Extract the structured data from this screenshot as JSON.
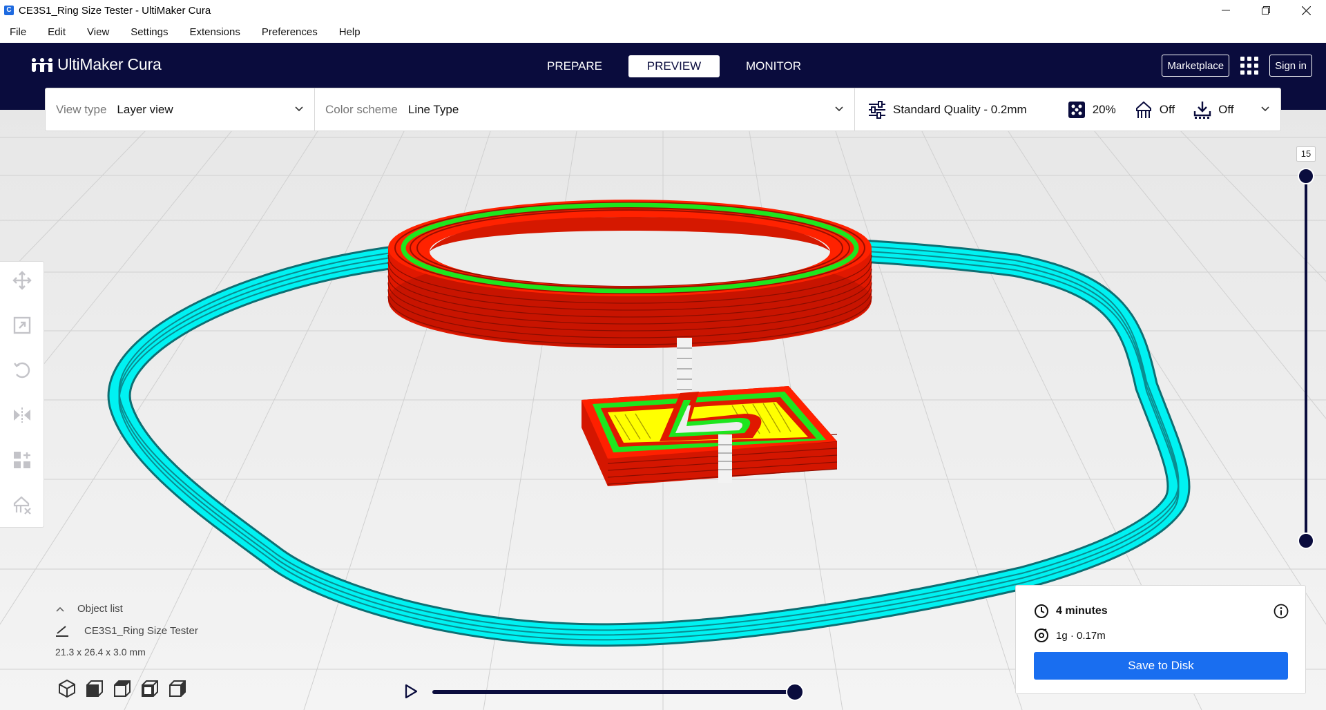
{
  "window": {
    "title": "CE3S1_Ring Size Tester - UltiMaker Cura",
    "app_icon_letter": "C"
  },
  "menu": [
    "File",
    "Edit",
    "View",
    "Settings",
    "Extensions",
    "Preferences",
    "Help"
  ],
  "header": {
    "brand": "UltiMaker Cura",
    "tabs": [
      {
        "label": "PREPARE",
        "active": false
      },
      {
        "label": "PREVIEW",
        "active": true
      },
      {
        "label": "MONITOR",
        "active": false
      }
    ],
    "marketplace_label": "Marketplace",
    "signin_label": "Sign in"
  },
  "toolbar": {
    "view_type_label": "View type",
    "view_type_value": "Layer view",
    "color_scheme_label": "Color scheme",
    "color_scheme_value": "Line Type",
    "quality": "Standard Quality - 0.2mm",
    "infill": "20%",
    "support": "Off",
    "adhesion": "Off"
  },
  "layer_slider": {
    "current_layer": "15"
  },
  "object_list": {
    "header": "Object list",
    "object_name": "CE3S1_Ring Size Tester",
    "dimensions": "21.3 x 26.4 x 3.0 mm"
  },
  "print_info": {
    "time": "4 minutes",
    "material": "1g · 0.17m",
    "save_label": "Save to Disk"
  },
  "colors": {
    "header_bg": "#0a0c3d",
    "accent_blue": "#196ef0",
    "wall_outer": "#ff1a00",
    "wall_inner": "#1ee61e",
    "infill": "#ffff00",
    "skirt": "#00ffff"
  }
}
